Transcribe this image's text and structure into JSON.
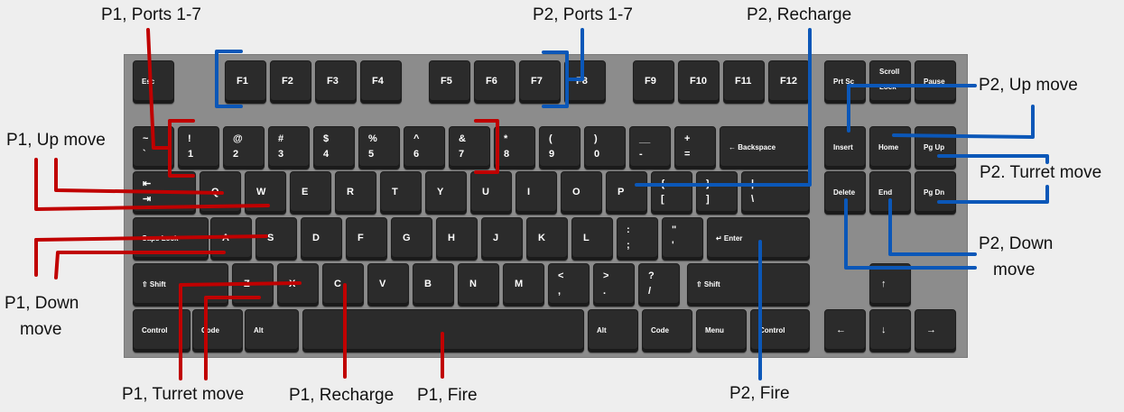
{
  "annotations": {
    "p1_ports": "P1, Ports 1-7",
    "p2_ports": "P2, Ports 1-7",
    "p2_recharge": "P2, Recharge",
    "p2_up": "P2, Up move",
    "p2_turret": "P2. Turret move",
    "p2_down_1": "P2, Down",
    "p2_down_2": "move",
    "p2_fire": "P2, Fire",
    "p1_up": "P1, Up move",
    "p1_down_1": "P1, Down",
    "p1_down_2": "move",
    "p1_turret": "P1, Turret move",
    "p1_recharge": "P1, Recharge",
    "p1_fire": "P1, Fire"
  },
  "colors": {
    "p1": "#c00000",
    "p2": "#0b57b8",
    "keyboard": "#8c8c8c",
    "key": "#2b2b2b"
  },
  "keys": [
    {
      "id": "esc",
      "top": "Esc",
      "small": true
    },
    {
      "id": "f1",
      "top": "F1"
    },
    {
      "id": "f2",
      "top": "F2"
    },
    {
      "id": "f3",
      "top": "F3"
    },
    {
      "id": "f4",
      "top": "F4"
    },
    {
      "id": "f5",
      "top": "F5"
    },
    {
      "id": "f6",
      "top": "F6"
    },
    {
      "id": "f7",
      "top": "F7"
    },
    {
      "id": "f8",
      "top": "F8"
    },
    {
      "id": "f9",
      "top": "F9"
    },
    {
      "id": "f10",
      "top": "F10"
    },
    {
      "id": "f11",
      "top": "F11"
    },
    {
      "id": "f12",
      "top": "F12"
    },
    {
      "id": "prtsc",
      "top": "Prt Sc",
      "small": true
    },
    {
      "id": "scroll",
      "top": "Scroll",
      "bottom": "Lock",
      "small": true
    },
    {
      "id": "pause",
      "top": "Pause",
      "small": true
    },
    {
      "id": "tilde",
      "top": "~",
      "bottom": "`"
    },
    {
      "id": "k1",
      "top": "!",
      "bottom": "1"
    },
    {
      "id": "k2",
      "top": "@",
      "bottom": "2"
    },
    {
      "id": "k3",
      "top": "#",
      "bottom": "3"
    },
    {
      "id": "k4",
      "top": "$",
      "bottom": "4"
    },
    {
      "id": "k5",
      "top": "%",
      "bottom": "5"
    },
    {
      "id": "k6",
      "top": "^",
      "bottom": "6"
    },
    {
      "id": "k7",
      "top": "&",
      "bottom": "7"
    },
    {
      "id": "k8",
      "top": "*",
      "bottom": "8"
    },
    {
      "id": "k9",
      "top": "(",
      "bottom": "9"
    },
    {
      "id": "k0",
      "top": ")",
      "bottom": "0"
    },
    {
      "id": "minus",
      "top": "__",
      "bottom": "-"
    },
    {
      "id": "equals",
      "top": "+",
      "bottom": "="
    },
    {
      "id": "backspace",
      "top": "← Backspace",
      "small": true
    },
    {
      "id": "insert",
      "top": "Insert",
      "small": true
    },
    {
      "id": "home",
      "top": "Home",
      "small": true
    },
    {
      "id": "pgup",
      "top": "Pg Up",
      "small": true
    },
    {
      "id": "tab",
      "top": "⇤",
      "bottom": "⇥"
    },
    {
      "id": "q",
      "top": "Q"
    },
    {
      "id": "w",
      "top": "W"
    },
    {
      "id": "e",
      "top": "E"
    },
    {
      "id": "r",
      "top": "R"
    },
    {
      "id": "t",
      "top": "T"
    },
    {
      "id": "y",
      "top": "Y"
    },
    {
      "id": "u",
      "top": "U"
    },
    {
      "id": "i",
      "top": "I"
    },
    {
      "id": "o",
      "top": "O"
    },
    {
      "id": "p",
      "top": "P"
    },
    {
      "id": "lbracket",
      "top": "{",
      "bottom": "["
    },
    {
      "id": "rbracket",
      "top": "}",
      "bottom": "]"
    },
    {
      "id": "backslash",
      "top": "|",
      "bottom": "\\"
    },
    {
      "id": "delete",
      "top": "Delete",
      "small": true
    },
    {
      "id": "end",
      "top": "End",
      "small": true
    },
    {
      "id": "pgdn",
      "top": "Pg Dn",
      "small": true
    },
    {
      "id": "caps",
      "top": "Caps Lock",
      "small": true
    },
    {
      "id": "a",
      "top": "A"
    },
    {
      "id": "s",
      "top": "S"
    },
    {
      "id": "d",
      "top": "D"
    },
    {
      "id": "f",
      "top": "F"
    },
    {
      "id": "g",
      "top": "G"
    },
    {
      "id": "h",
      "top": "H"
    },
    {
      "id": "j",
      "top": "J"
    },
    {
      "id": "k",
      "top": "K"
    },
    {
      "id": "l",
      "top": "L"
    },
    {
      "id": "semicolon",
      "top": ":",
      "bottom": ";"
    },
    {
      "id": "quote",
      "top": "\"",
      "bottom": "'"
    },
    {
      "id": "enter",
      "top": "↵ Enter",
      "small": true
    },
    {
      "id": "lshift",
      "top": "⇧ Shift",
      "small": true
    },
    {
      "id": "z",
      "top": "Z"
    },
    {
      "id": "x",
      "top": "X"
    },
    {
      "id": "c",
      "top": "C"
    },
    {
      "id": "v",
      "top": "V"
    },
    {
      "id": "b",
      "top": "B"
    },
    {
      "id": "n",
      "top": "N"
    },
    {
      "id": "m",
      "top": "M"
    },
    {
      "id": "comma",
      "top": "<",
      "bottom": ","
    },
    {
      "id": "period",
      "top": ">",
      "bottom": "."
    },
    {
      "id": "slash",
      "top": "?",
      "bottom": "/"
    },
    {
      "id": "rshift",
      "top": "⇧ Shift",
      "small": true
    },
    {
      "id": "uparrow",
      "top": "↑"
    },
    {
      "id": "lcontrol",
      "top": "Control",
      "small": true
    },
    {
      "id": "lcode",
      "top": "Code",
      "small": true
    },
    {
      "id": "lalt",
      "top": "Alt",
      "small": true
    },
    {
      "id": "space",
      "top": ""
    },
    {
      "id": "ralt",
      "top": "Alt",
      "small": true
    },
    {
      "id": "rcode",
      "top": "Code",
      "small": true
    },
    {
      "id": "menu",
      "top": "Menu",
      "small": true
    },
    {
      "id": "rcontrol",
      "top": "Control",
      "small": true
    },
    {
      "id": "leftarrow",
      "top": "←"
    },
    {
      "id": "downarrow",
      "top": "↓"
    },
    {
      "id": "rightarrow",
      "top": "→"
    }
  ]
}
